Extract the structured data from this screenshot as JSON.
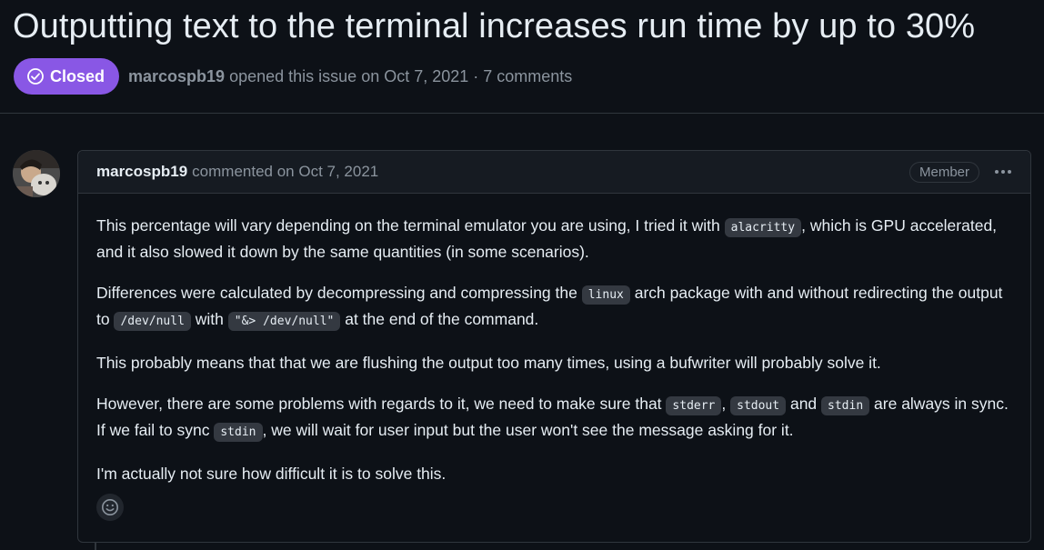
{
  "issue": {
    "title": "Outputting text to the terminal increases run time by up to 30%",
    "state_label": "Closed",
    "author": "marcospb19",
    "meta_text": "opened this issue on Oct 7, 2021 · 7 comments"
  },
  "comment": {
    "author": "marcospb19",
    "action_text": "commented on Oct 7, 2021",
    "role_badge": "Member",
    "body": {
      "p1_a": "This percentage will vary depending on the terminal emulator you are using, I tried it with ",
      "p1_code1": "alacritty",
      "p1_b": ", which is GPU accelerated, and it also slowed it down by the same quantities (in some scenarios).",
      "p2_a": "Differences were calculated by decompressing and compressing the ",
      "p2_code1": "linux",
      "p2_b": " arch package with and without redirecting the output to ",
      "p2_code2": "/dev/null",
      "p2_c": " with ",
      "p2_code3": "\"&> /dev/null\"",
      "p2_d": " at the end of the command.",
      "p3": "This probably means that that we are flushing the output too many times, using a bufwriter will probably solve it.",
      "p4_a": "However, there are some problems with regards to it, we need to make sure that ",
      "p4_code1": "stderr",
      "p4_b": ", ",
      "p4_code2": "stdout",
      "p4_c": " and ",
      "p4_code3": "stdin",
      "p4_d": " are always in sync. If we fail to sync ",
      "p4_code4": "stdin",
      "p4_e": ", we will wait for user input but the user won't see the message asking for it.",
      "p5": "I'm actually not sure how difficult it is to solve this."
    }
  },
  "icons": {
    "state": "check-circle-icon",
    "menu": "kebab-horizontal-icon",
    "reaction": "smiley-icon"
  },
  "colors": {
    "background": "#0d1117",
    "closed_badge": "#8957e5",
    "border": "#30363d",
    "muted_text": "#8b949e"
  }
}
